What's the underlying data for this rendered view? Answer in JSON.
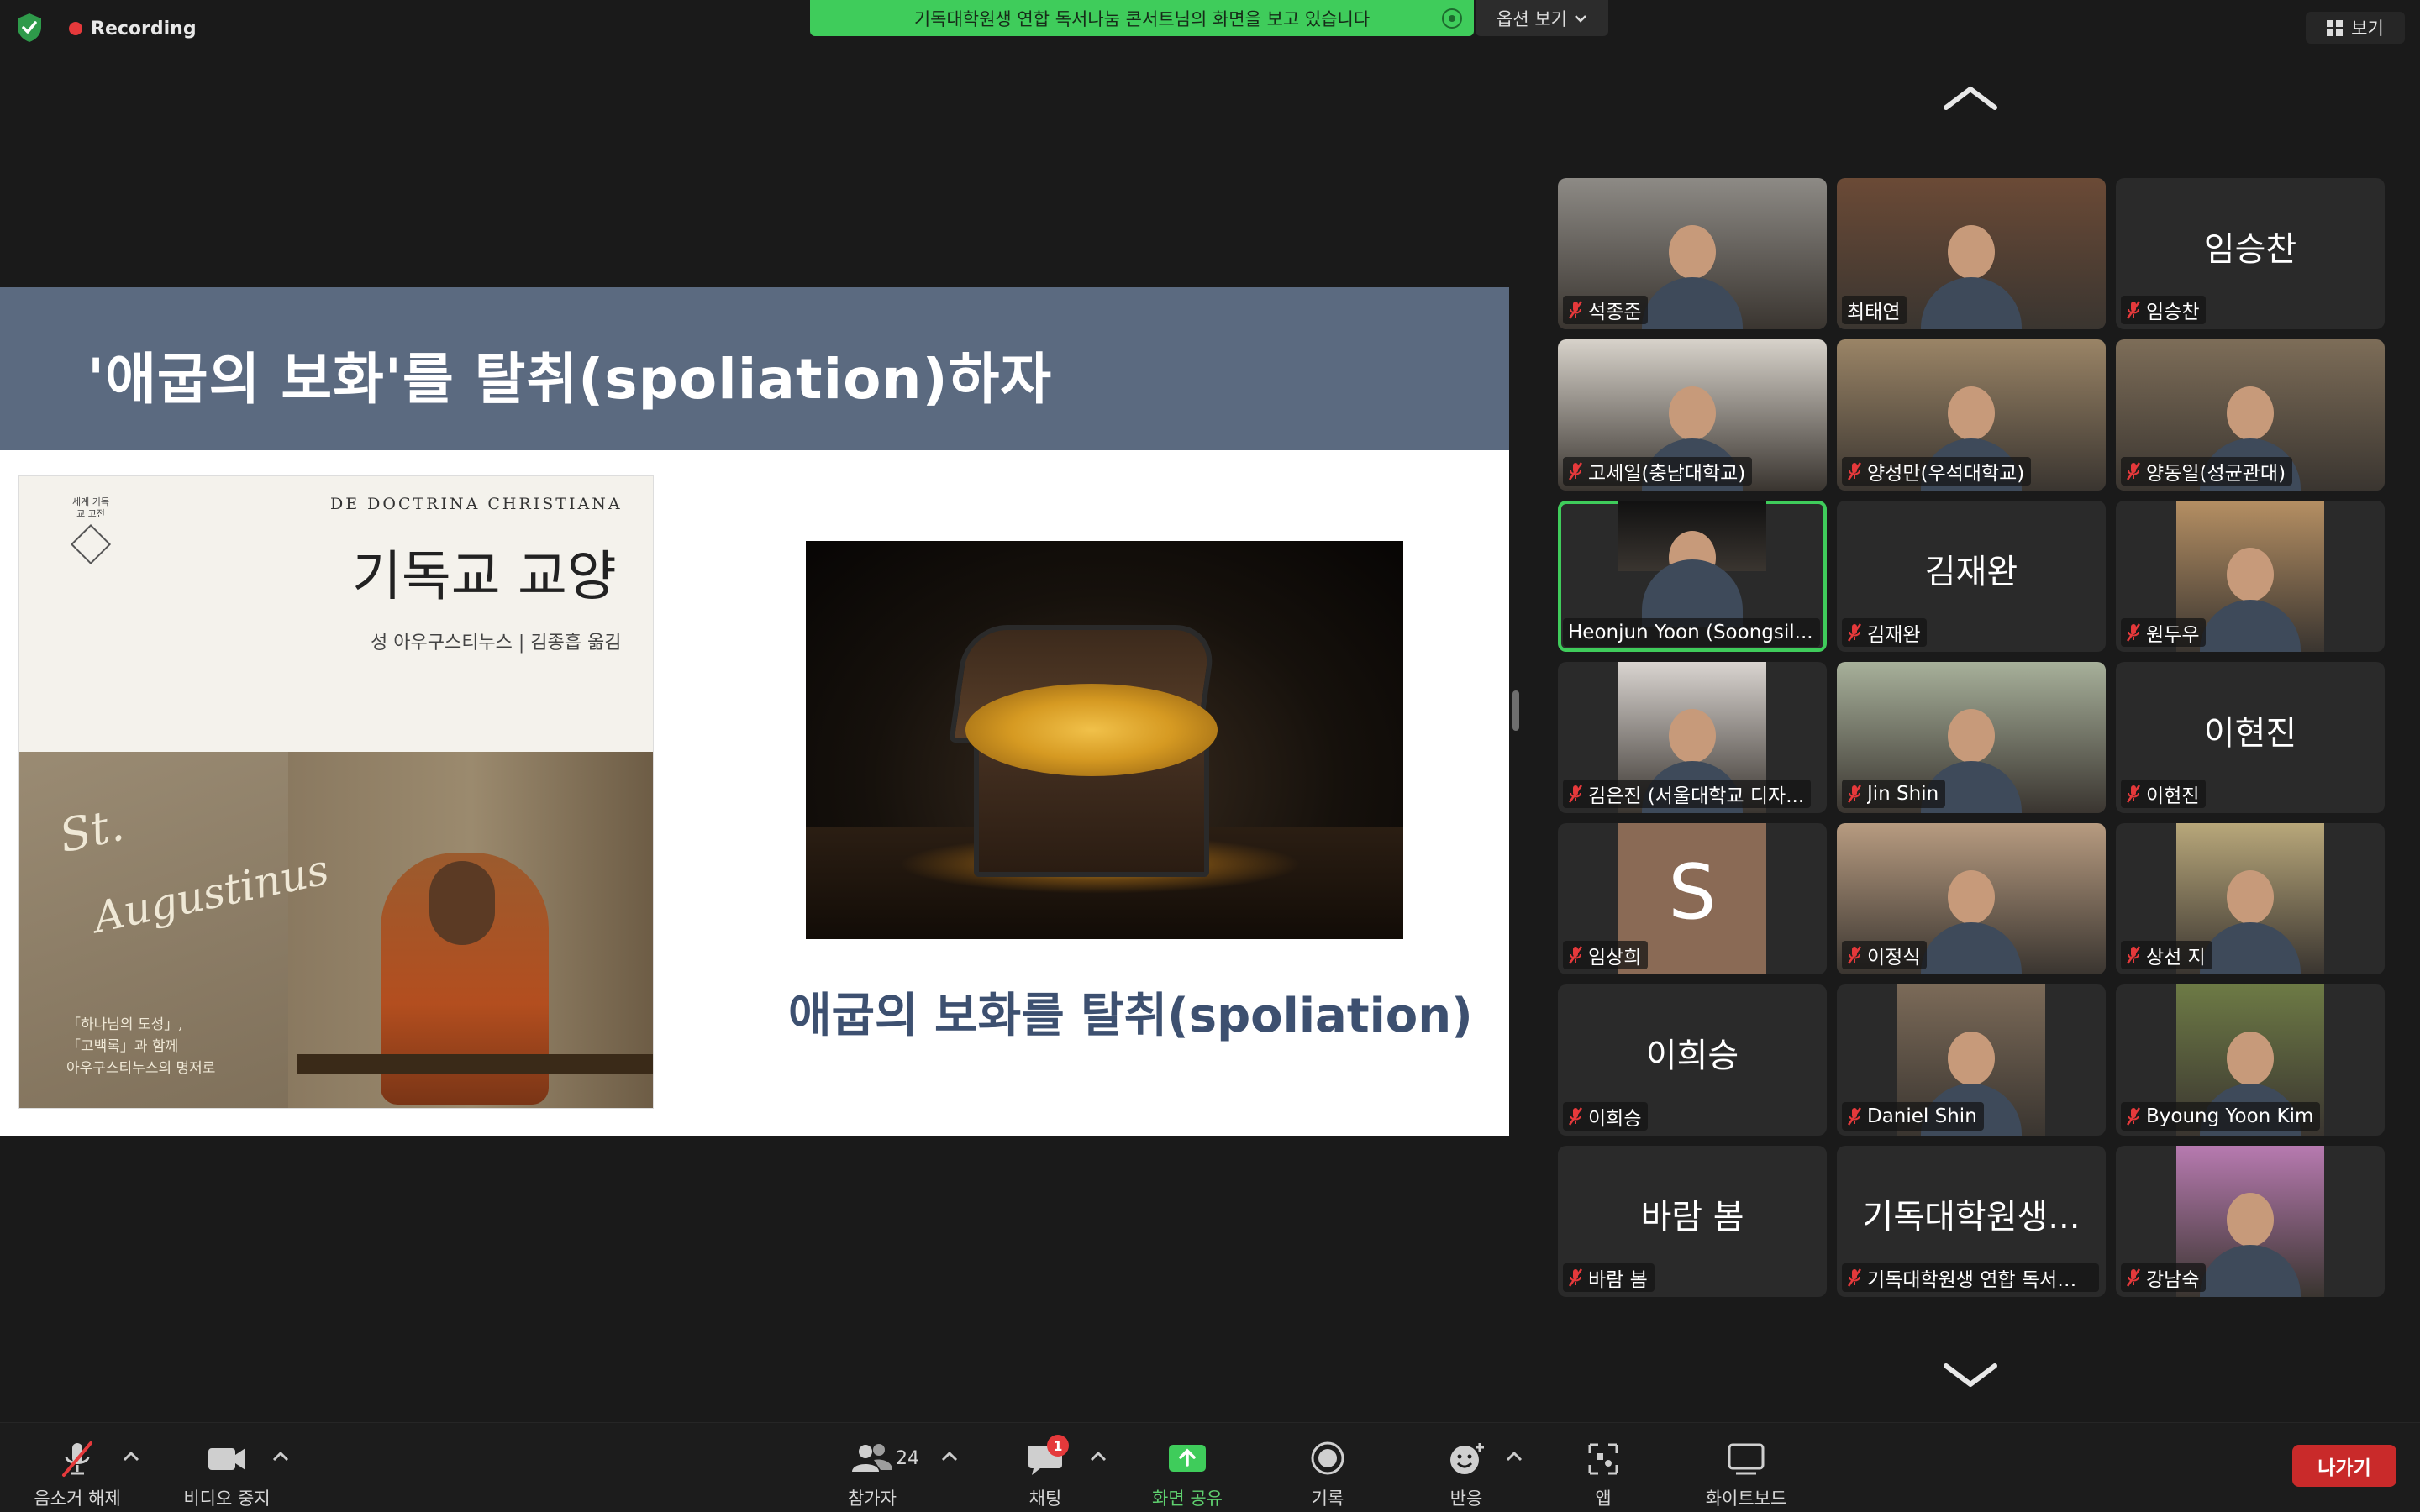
{
  "topbar": {
    "recording_label": "Recording",
    "share_banner_text": "기독대학원생 연합 독서나눔 콘서트님의 화면을 보고 있습니다",
    "view_options_label": "옵션 보기",
    "view_label": "보기"
  },
  "slide": {
    "title": "'애굽의 보화'를 탈취(spoliation)하자",
    "caption": "애굽의 보화를 탈취(spoliation)",
    "book": {
      "series": "세계 기독교 고전",
      "latin_title": "DE DOCTRINA CHRISTIANA",
      "title": "기독교 교양",
      "author": "성 아우구스티누스 | 김종흡 옮김",
      "st": "St.",
      "augustinus": "Augustinus",
      "sub1": "「하나님의 도성」,",
      "sub2": "「고백록」과 함께",
      "sub3": "아우구스티누스의 명저로"
    }
  },
  "participants": [
    {
      "name": "석종준",
      "muted": true,
      "video": true,
      "bg": "#8d8a85"
    },
    {
      "name": "최태연",
      "muted": false,
      "video": true,
      "bg": "#6b4a36"
    },
    {
      "name": "임승찬",
      "muted": true,
      "video": false,
      "big": "임승찬"
    },
    {
      "name": "고세일(충남대학교)",
      "muted": true,
      "video": true,
      "bg": "#d7d2ca"
    },
    {
      "name": "양성만(우석대학교)",
      "muted": true,
      "video": true,
      "bg": "#9a8466"
    },
    {
      "name": "양동일(성균관대)",
      "muted": true,
      "video": true,
      "bg": "#7d6d58"
    },
    {
      "name": "Heonjun Yoon (Soongsil...",
      "muted": false,
      "video": true,
      "bg": "#111111",
      "active": true
    },
    {
      "name": "김재완",
      "muted": true,
      "video": false,
      "big": "김재완"
    },
    {
      "name": "원두우",
      "muted": true,
      "video": true,
      "bg": "#b58f63"
    },
    {
      "name": "김은진 (서울대학교 디자...",
      "muted": true,
      "video": true,
      "bg": "#d9d4d0"
    },
    {
      "name": "Jin Shin",
      "muted": true,
      "video": true,
      "bg": "#a7b09a"
    },
    {
      "name": "이현진",
      "muted": true,
      "video": false,
      "big": "이현진"
    },
    {
      "name": "임상희",
      "muted": true,
      "video": true,
      "bg": "#8a6a55",
      "avatar": "S"
    },
    {
      "name": "이정식",
      "muted": true,
      "video": true,
      "bg": "#b79b80"
    },
    {
      "name": "상선 지",
      "muted": true,
      "video": true,
      "bg": "#b8a77a"
    },
    {
      "name": "이희승",
      "muted": true,
      "video": false,
      "big": "이희승"
    },
    {
      "name": "Daniel Shin",
      "muted": true,
      "video": true,
      "bg": "#7b6a58"
    },
    {
      "name": "Byoung Yoon Kim",
      "muted": true,
      "video": true,
      "bg": "#6d7a45"
    },
    {
      "name": "바람 봄",
      "muted": true,
      "video": false,
      "big": "바람 봄"
    },
    {
      "name": "기독대학원생 연합 독서나...",
      "muted": true,
      "video": false,
      "big": "기독대학원생..."
    },
    {
      "name": "강남숙",
      "muted": true,
      "video": true,
      "bg": "#b77ab0"
    }
  ],
  "toolbar": {
    "unmute_label": "음소거 해제",
    "stop_video_label": "비디오 중지",
    "participants_label": "참가자",
    "participants_count": "24",
    "chat_label": "채팅",
    "chat_badge": "1",
    "share_label": "화면 공유",
    "record_label": "기록",
    "reactions_label": "반응",
    "apps_label": "앱",
    "whiteboard_label": "화이트보드",
    "leave_label": "나가기"
  },
  "colors": {
    "accent_green": "#3fcc5b",
    "leave_red": "#c92a2a",
    "muted_red": "#e5393b",
    "slide_band": "#5b6a80"
  }
}
